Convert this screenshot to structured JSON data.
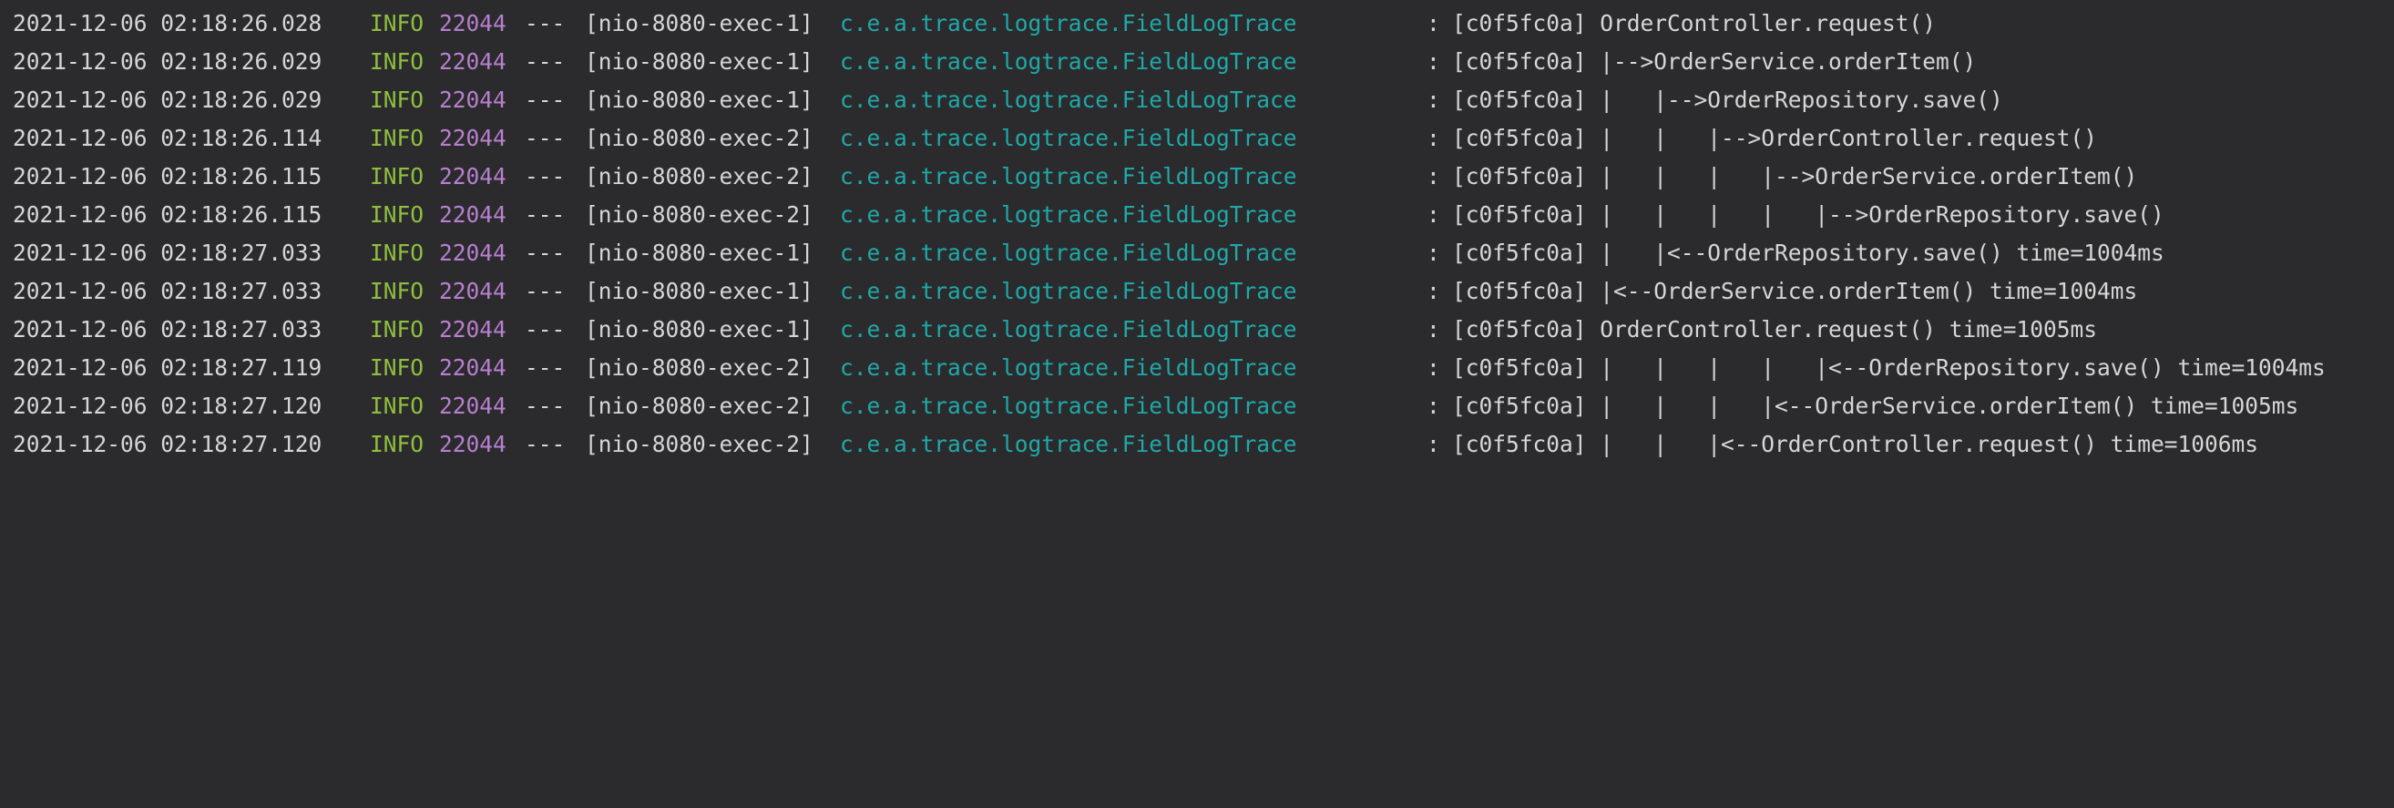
{
  "colors": {
    "background": "#2b2b2d",
    "text": "#d6d6d6",
    "level": "#8fbf3e",
    "pid": "#b87fcf",
    "logger": "#20a8a8"
  },
  "lines": [
    {
      "timestamp": "2021-12-06 02:18:26.028",
      "level": "INFO",
      "pid": "22044",
      "sep": "---",
      "thread": "[nio-8080-exec-1]",
      "logger": "c.e.a.trace.logtrace.FieldLogTrace",
      "colon": ":",
      "message": "[c0f5fc0a] OrderController.request()"
    },
    {
      "timestamp": "2021-12-06 02:18:26.029",
      "level": "INFO",
      "pid": "22044",
      "sep": "---",
      "thread": "[nio-8080-exec-1]",
      "logger": "c.e.a.trace.logtrace.FieldLogTrace",
      "colon": ":",
      "message": "[c0f5fc0a] |-->OrderService.orderItem()"
    },
    {
      "timestamp": "2021-12-06 02:18:26.029",
      "level": "INFO",
      "pid": "22044",
      "sep": "---",
      "thread": "[nio-8080-exec-1]",
      "logger": "c.e.a.trace.logtrace.FieldLogTrace",
      "colon": ":",
      "message": "[c0f5fc0a] |   |-->OrderRepository.save()"
    },
    {
      "timestamp": "2021-12-06 02:18:26.114",
      "level": "INFO",
      "pid": "22044",
      "sep": "---",
      "thread": "[nio-8080-exec-2]",
      "logger": "c.e.a.trace.logtrace.FieldLogTrace",
      "colon": ":",
      "message": "[c0f5fc0a] |   |   |-->OrderController.request()"
    },
    {
      "timestamp": "2021-12-06 02:18:26.115",
      "level": "INFO",
      "pid": "22044",
      "sep": "---",
      "thread": "[nio-8080-exec-2]",
      "logger": "c.e.a.trace.logtrace.FieldLogTrace",
      "colon": ":",
      "message": "[c0f5fc0a] |   |   |   |-->OrderService.orderItem()"
    },
    {
      "timestamp": "2021-12-06 02:18:26.115",
      "level": "INFO",
      "pid": "22044",
      "sep": "---",
      "thread": "[nio-8080-exec-2]",
      "logger": "c.e.a.trace.logtrace.FieldLogTrace",
      "colon": ":",
      "message": "[c0f5fc0a] |   |   |   |   |-->OrderRepository.save()"
    },
    {
      "timestamp": "2021-12-06 02:18:27.033",
      "level": "INFO",
      "pid": "22044",
      "sep": "---",
      "thread": "[nio-8080-exec-1]",
      "logger": "c.e.a.trace.logtrace.FieldLogTrace",
      "colon": ":",
      "message": "[c0f5fc0a] |   |<--OrderRepository.save() time=1004ms"
    },
    {
      "timestamp": "2021-12-06 02:18:27.033",
      "level": "INFO",
      "pid": "22044",
      "sep": "---",
      "thread": "[nio-8080-exec-1]",
      "logger": "c.e.a.trace.logtrace.FieldLogTrace",
      "colon": ":",
      "message": "[c0f5fc0a] |<--OrderService.orderItem() time=1004ms"
    },
    {
      "timestamp": "2021-12-06 02:18:27.033",
      "level": "INFO",
      "pid": "22044",
      "sep": "---",
      "thread": "[nio-8080-exec-1]",
      "logger": "c.e.a.trace.logtrace.FieldLogTrace",
      "colon": ":",
      "message": "[c0f5fc0a] OrderController.request() time=1005ms"
    },
    {
      "timestamp": "2021-12-06 02:18:27.119",
      "level": "INFO",
      "pid": "22044",
      "sep": "---",
      "thread": "[nio-8080-exec-2]",
      "logger": "c.e.a.trace.logtrace.FieldLogTrace",
      "colon": ":",
      "message": "[c0f5fc0a] |   |   |   |   |<--OrderRepository.save() time=1004ms"
    },
    {
      "timestamp": "2021-12-06 02:18:27.120",
      "level": "INFO",
      "pid": "22044",
      "sep": "---",
      "thread": "[nio-8080-exec-2]",
      "logger": "c.e.a.trace.logtrace.FieldLogTrace",
      "colon": ":",
      "message": "[c0f5fc0a] |   |   |   |<--OrderService.orderItem() time=1005ms"
    },
    {
      "timestamp": "2021-12-06 02:18:27.120",
      "level": "INFO",
      "pid": "22044",
      "sep": "---",
      "thread": "[nio-8080-exec-2]",
      "logger": "c.e.a.trace.logtrace.FieldLogTrace",
      "colon": ":",
      "message": "[c0f5fc0a] |   |   |<--OrderController.request() time=1006ms"
    }
  ]
}
